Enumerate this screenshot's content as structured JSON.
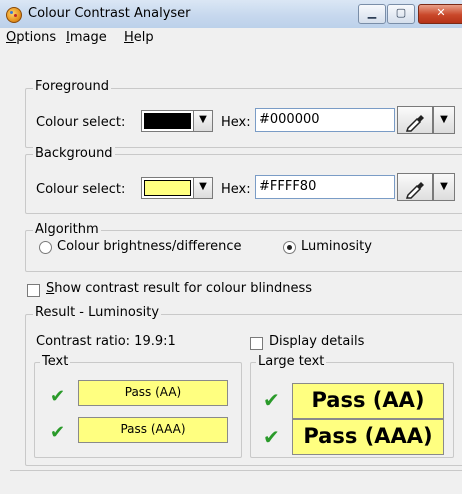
{
  "window": {
    "title": "Colour Contrast Analyser"
  },
  "menu": {
    "options": "ptions",
    "options_u": "O",
    "image": "mage",
    "image_u": "I",
    "help": "elp",
    "help_u": "H"
  },
  "foreground": {
    "group_label": "Foreground",
    "colour_select_label": "Colour select:",
    "hex_label": "Hex:",
    "hex_value": "#000000",
    "colour": "#000000"
  },
  "background": {
    "group_label": "Background",
    "colour_select_label": "Colour select:",
    "hex_label": "Hex:",
    "hex_value": "#FFFF80",
    "colour": "#FFFF80"
  },
  "algorithm": {
    "group_label": "Algorithm",
    "options": [
      "Colour brightness/difference",
      "Luminosity"
    ],
    "selected": "Luminosity"
  },
  "blindness": {
    "label_u": "S",
    "label": "how contrast result for colour blindness",
    "checked": false
  },
  "result": {
    "group_label": "Result - Luminosity",
    "contrast_ratio": "Contrast ratio: 19.9:1",
    "display_details": "Display details",
    "text_group": "Text",
    "large_text_group": "Large text",
    "text_aa": "Pass (AA)",
    "text_aaa": "Pass (AAA)",
    "large_aa": "Pass (AA)",
    "large_aaa": "Pass (AAA)"
  },
  "colors": {
    "pass_bg": "#FFFF80",
    "tick": "#2A9A2A"
  }
}
